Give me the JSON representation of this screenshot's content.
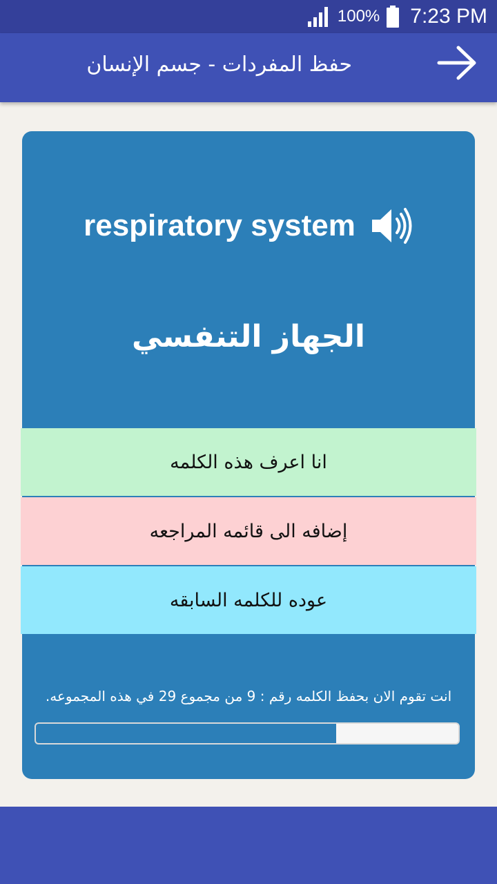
{
  "status_bar": {
    "battery_percent": "100%",
    "time": "7:23 PM",
    "icons": [
      "signal-icon",
      "battery-icon"
    ]
  },
  "app_bar": {
    "title": "حفظ المفردات - جسم الإنسان",
    "back_icon": "arrow-right-icon"
  },
  "card": {
    "english_word": "respiratory system",
    "speaker_icon": "speaker-icon",
    "arabic_word": "الجهاز التنفسي",
    "buttons": {
      "know": "انا اعرف هذه الكلمه",
      "review": "إضافه الى قائمه المراجعه",
      "previous": "عوده للكلمه السابقه"
    },
    "progress": {
      "text": "انت تقوم الان بحفظ الكلمه رقم : 9 من مجموع 29 في هذه المجموعه.",
      "current": 9,
      "total": 29,
      "fill_fraction": 0.71
    }
  },
  "colors": {
    "app_bar": "#3f51b5",
    "status_bar": "#34409a",
    "card": "#2c7fb8",
    "know_button": "#c2f3cf",
    "review_button": "#fdd1d3",
    "previous_button": "#92e8fd",
    "background": "#f3f1ec"
  }
}
